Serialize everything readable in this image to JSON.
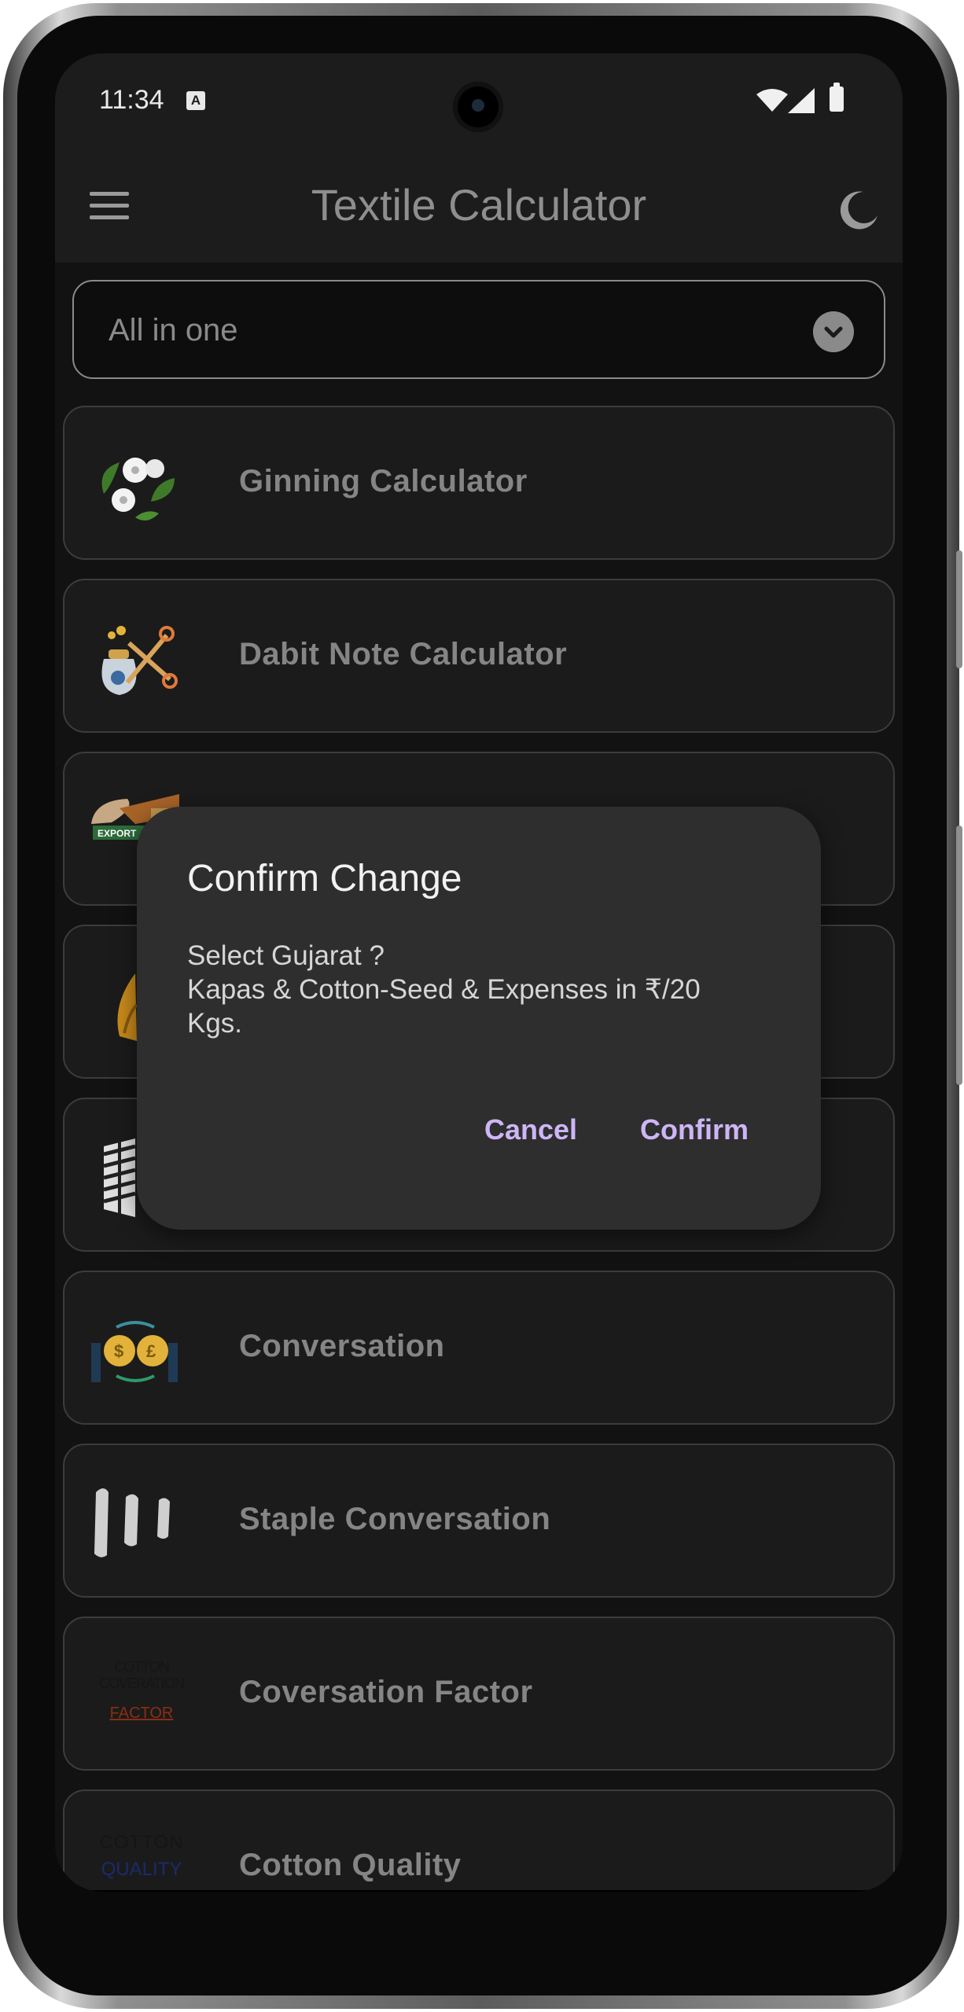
{
  "status_bar": {
    "time": "11:34",
    "notification_icon": "A"
  },
  "app_bar": {
    "title": "Textile Calculator",
    "menu_icon": "hamburger-menu-icon",
    "theme_icon": "moon-icon"
  },
  "dropdown": {
    "selected": "All in one"
  },
  "cards": [
    {
      "label": "Ginning Calculator",
      "icon": "cotton-flower-icon"
    },
    {
      "label": "Dabit Note Calculator",
      "icon": "money-bag-scissors-icon"
    },
    {
      "label": "",
      "icon": "export-icon"
    },
    {
      "label": "",
      "icon": "yarn-icon"
    },
    {
      "label": "",
      "icon": "fabric-icon"
    },
    {
      "label": "Conversation",
      "icon": "currency-exchange-icon"
    },
    {
      "label": "Staple Conversation",
      "icon": "staple-fiber-icon"
    },
    {
      "label": "Coversation Factor",
      "icon": "text-logo-icon",
      "logo_text_1": "COTTON COVERATION",
      "logo_text_2": "FACTOR"
    },
    {
      "label": "Cotton Quality",
      "icon": "text-logo-icon",
      "logo_text_1": "COTTON",
      "logo_text_2": "QUALITY"
    }
  ],
  "dialog": {
    "title": "Confirm Change",
    "message_line1": "Select Gujarat ?",
    "message_line2": "Kapas & Cotton-Seed & Expenses in ₹/20 Kgs.",
    "cancel_label": "Cancel",
    "confirm_label": "Confirm"
  },
  "colors": {
    "background": "#121212",
    "card": "#1b1b1b",
    "dialog": "#2e2e2e",
    "accent": "#cdb6f5"
  }
}
